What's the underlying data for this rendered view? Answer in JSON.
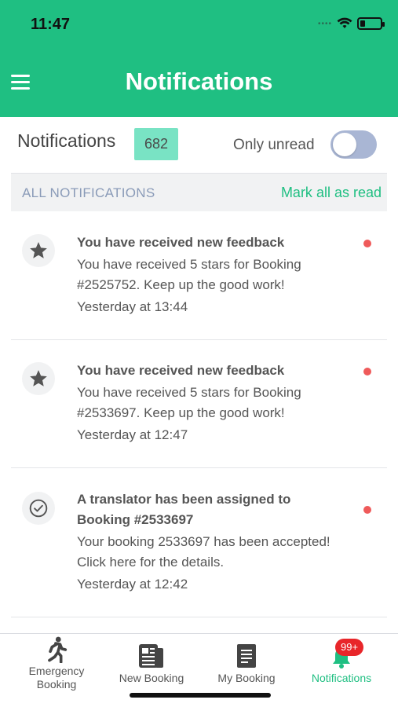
{
  "status_bar": {
    "time": "11:47"
  },
  "header": {
    "title": "Notifications",
    "menu_icon": "hamburger-menu-icon",
    "color": "#1fbf82"
  },
  "subheader": {
    "title": "Notifications",
    "count": "682",
    "only_unread_label": "Only unread",
    "only_unread_on": false
  },
  "filter": {
    "label": "ALL NOTIFICATIONS",
    "mark_all": "Mark all as read"
  },
  "notifications": [
    {
      "icon": "star-icon",
      "title": "You have received new feedback",
      "body": [
        "You have received 5 stars for Booking",
        "#2525752. Keep up the good work!"
      ],
      "time": "Yesterday at 13:44",
      "unread": true
    },
    {
      "icon": "star-icon",
      "title": "You have received new feedback",
      "body": [
        "You have received 5 stars for Booking",
        "#2533697. Keep up the good work!"
      ],
      "time": "Yesterday at 12:47",
      "unread": true
    },
    {
      "icon": "check-circle-icon",
      "title": [
        "A translator has been assigned to",
        "Booking #2533697"
      ],
      "body": [
        "Your booking 2533697 has been accepted!",
        "Click here for the details."
      ],
      "time": "Yesterday at 12:42",
      "unread": true
    }
  ],
  "tabbar": {
    "tabs": [
      {
        "label_lines": [
          "Emergency",
          "Booking"
        ],
        "icon": "walking-person-icon"
      },
      {
        "label": "New Booking",
        "icon": "document-icon"
      },
      {
        "label": "My Booking",
        "icon": "file-icon"
      },
      {
        "label": "Notifications",
        "icon": "bell-icon",
        "badge": "99+",
        "active": true
      }
    ]
  }
}
